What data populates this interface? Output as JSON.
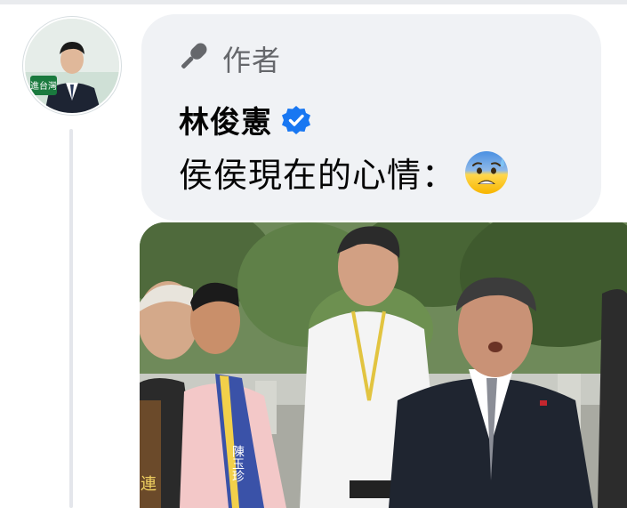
{
  "avatar": {
    "alt": "Profile picture",
    "badge_text": "進台灣"
  },
  "comment": {
    "author_tag": "作者",
    "author_name": "林俊憲",
    "verified": true,
    "text": "侯侯現在的心情：",
    "emoji": "anxious-face-with-sweat"
  },
  "photo": {
    "sash_text": "陳玉珍",
    "banner_text": "連"
  },
  "colors": {
    "bubble": "#f0f2f5",
    "verified": "#1877f2",
    "muted": "#65676b"
  }
}
